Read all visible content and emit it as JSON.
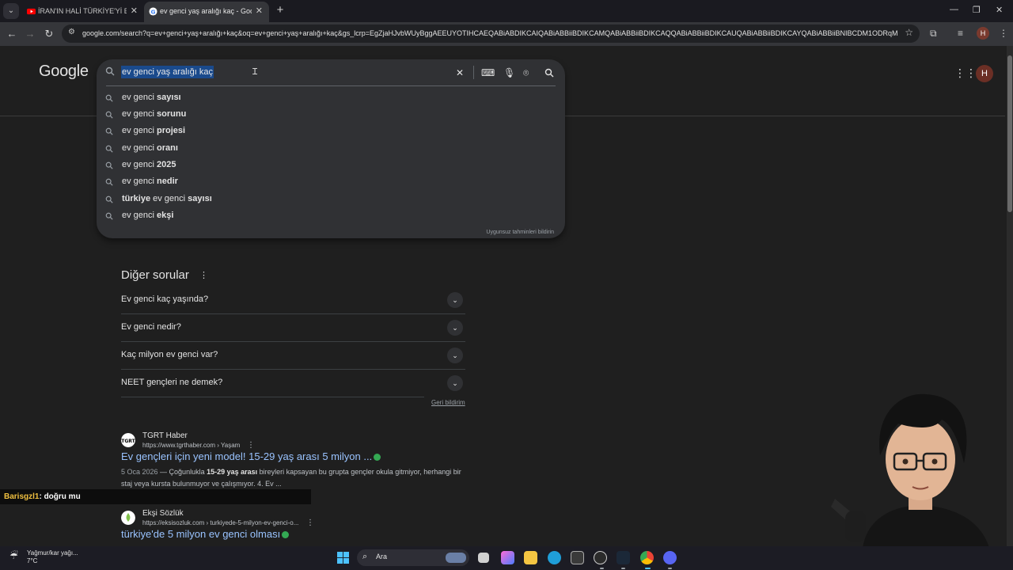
{
  "browser": {
    "tabs": [
      {
        "title": "İRAN'IN HALİ TÜRKİYE'Yİ ETKİLE...",
        "active": false
      },
      {
        "title": "ev genci yaş aralığı kaç - Google",
        "active": true
      }
    ],
    "url": "google.com/search?q=ev+genci+yaş+aralığı+kaç&oq=ev+genci+yaş+aralığı+kaç&gs_lcrp=EgZjaHJvbWUyBggAEEUYOTIHCAEQABiABDIKCAIQABiABBiiBDIKCAMQABiABBiiBDIKCAQQABiABBiiBDIKCAUQABiABBiiBDIKCAYQABiABBiiBNIBCDM1ODRqM...",
    "profile_initial": "H"
  },
  "google": {
    "logo": "Google",
    "profile_initial": "H",
    "query": "ev genci yaş aralığı kaç",
    "suggestions": [
      {
        "prefix": "ev genci ",
        "bold": "sayısı",
        "suffix": ""
      },
      {
        "prefix": "ev genci ",
        "bold": "sorunu",
        "suffix": ""
      },
      {
        "prefix": "ev genci ",
        "bold": "projesi",
        "suffix": ""
      },
      {
        "prefix": "ev genci ",
        "bold": "oranı",
        "suffix": ""
      },
      {
        "prefix": "ev genci ",
        "bold": "2025",
        "suffix": ""
      },
      {
        "prefix": "ev genci ",
        "bold": "nedir",
        "suffix": ""
      },
      {
        "prefix": "",
        "bold": "türkiye",
        "suffix": " ev genci ",
        "bold2": "sayısı"
      },
      {
        "prefix": "ev genci ",
        "bold": "ekşi",
        "suffix": ""
      }
    ],
    "report_label": "Uygunsuz tahminleri bildirin",
    "paa": {
      "title": "Diğer sorular",
      "questions": [
        "Ev genci kaç yaşında?",
        "Ev genci nedir?",
        "Kaç milyon ev genci var?",
        "NEET gençleri ne demek?"
      ],
      "feedback": "Geri bildirim"
    },
    "results": [
      {
        "site": "TGRT Haber",
        "url": "https://www.tgrthaber.com › Yaşam",
        "title": "Ev gençleri için yeni model! 15-29 yaş arası 5 milyon ...",
        "date": "5 Oca 2026",
        "snippet_a": " — Çoğunlukla ",
        "snippet_bold": "15-29 yaş arası",
        "snippet_b": " bireyleri kapsayan bu grupta gençler okula gitmiyor, herhangi bir staj veya kursta bulunmuyor ve çalışmıyor. 4. Ev ..."
      },
      {
        "site": "Ekşi Sözlük",
        "url": "https://eksisozluk.com › turkiyede-5-milyon-ev-genci-o...",
        "title": "türkiye'de 5 milyon ev genci olması"
      }
    ]
  },
  "chat": {
    "user": "Barisgzl1",
    "message": ": doğru mu"
  },
  "taskbar": {
    "weather_line1": "Yağmur/kar yağı...",
    "weather_line2": "7°C",
    "search_label": "Ara",
    "colors": {
      "accent": "#99c3ff",
      "highlight": "#1a4a8c",
      "bg": "#1f1f1f"
    }
  }
}
